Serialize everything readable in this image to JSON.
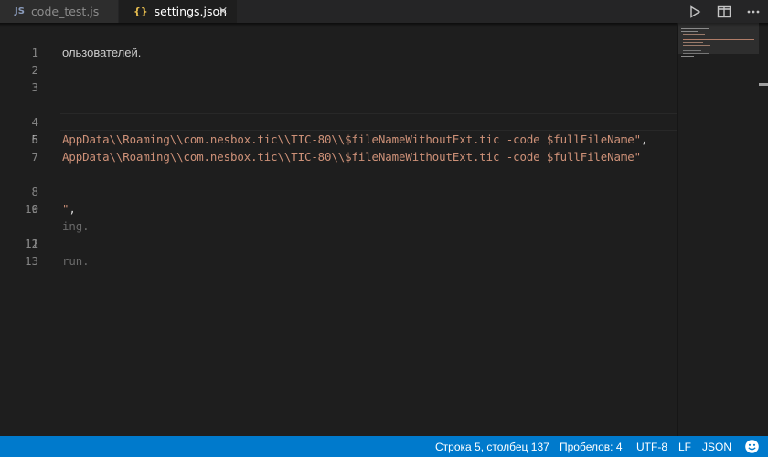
{
  "tabs": [
    {
      "type_badge": "JS",
      "label": "code_test.js",
      "active": false
    },
    {
      "type_badge": "{}",
      "label": "settings.json",
      "active": true
    }
  ],
  "tab_close_glyph": "×",
  "toolbar": {
    "run_icon": "play-icon",
    "split_icon": "split-editor-icon",
    "more_icon": "more-icon"
  },
  "editor": {
    "header_text": "ользователей.",
    "line_numbers": [
      "1",
      "2",
      "3",
      "4",
      "5",
      "6",
      "7",
      "8",
      "9",
      "10",
      "11",
      "12",
      "13"
    ],
    "current_line": "5",
    "lines": {
      "l4": {
        "str": "AppData\\\\Roaming\\\\com.nesbox.tic\\\\TIC-80\\\\$fileNameWithoutExt.tic -code $fullFileName\"",
        "punc": ","
      },
      "l5": {
        "str": "AppData\\\\Roaming\\\\com.nesbox.tic\\\\TIC-80\\\\$fileNameWithoutExt.tic -code $fullFileName\""
      },
      "l8": {
        "str": "\"",
        "punc": ","
      },
      "l9": {
        "cmt": "ing."
      },
      "l11": {
        "cmt": "run."
      }
    }
  },
  "status": {
    "position": "Строка 5, столбец 137",
    "indent": "Пробелов: 4",
    "encoding": "UTF-8",
    "eol": "LF",
    "language": "JSON",
    "feedback_icon": "smiley-icon"
  },
  "colors": {
    "string": "#ce9178",
    "statusbar": "#007acc",
    "editor_bg": "#1e1e1e"
  }
}
